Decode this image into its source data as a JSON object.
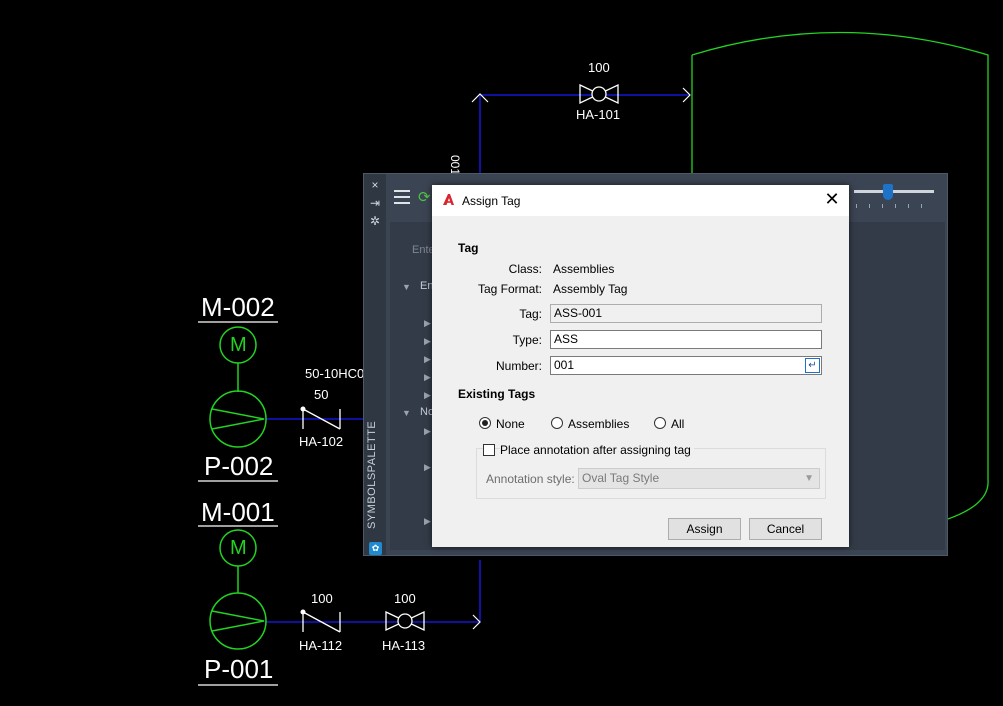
{
  "drawing": {
    "motor_top": "M-002",
    "pump_top": "P-002",
    "motor_bottom": "M-001",
    "pump_bottom": "P-001",
    "valve_top_size": "100",
    "valve_top_tag": "HA-101",
    "line_vertical_label": "001",
    "line_label": "50-10HC0",
    "check_valve_1_size": "50",
    "check_valve_1_tag": "HA-102",
    "check_valve_2_size": "100",
    "check_valve_2_tag": "HA-112",
    "valve_bottom_size": "100",
    "valve_bottom_tag": "HA-113",
    "motor_symbol": "M",
    "line_color": "#1a1aff",
    "equipment_color": "#22d322"
  },
  "palette": {
    "vertical_title": "SYMBOLSPALETTE",
    "search_placeholder": "Ente",
    "group1": "En",
    "group2": "No",
    "close_icon": "×",
    "pin_icon": "⇥",
    "settings_icon": "✲"
  },
  "dialog": {
    "title": "Assign Tag",
    "close_label": "✕",
    "tag_section": "Tag",
    "class_label": "Class:",
    "class_value": "Assemblies",
    "tag_format_label": "Tag Format:",
    "tag_format_value": "Assembly Tag",
    "tag_label": "Tag:",
    "tag_value": "ASS-001",
    "type_label": "Type:",
    "type_value": "ASS",
    "number_label": "Number:",
    "number_value": "001",
    "existing_section": "Existing Tags",
    "radio_none": "None",
    "radio_assemblies": "Assemblies",
    "radio_all": "All",
    "radio_selected": "None",
    "place_annotation_label": "Place annotation after assigning tag",
    "place_annotation_checked": false,
    "annotation_style_label": "Annotation style:",
    "annotation_style_value": "Oval Tag Style",
    "assign_button": "Assign",
    "cancel_button": "Cancel"
  }
}
